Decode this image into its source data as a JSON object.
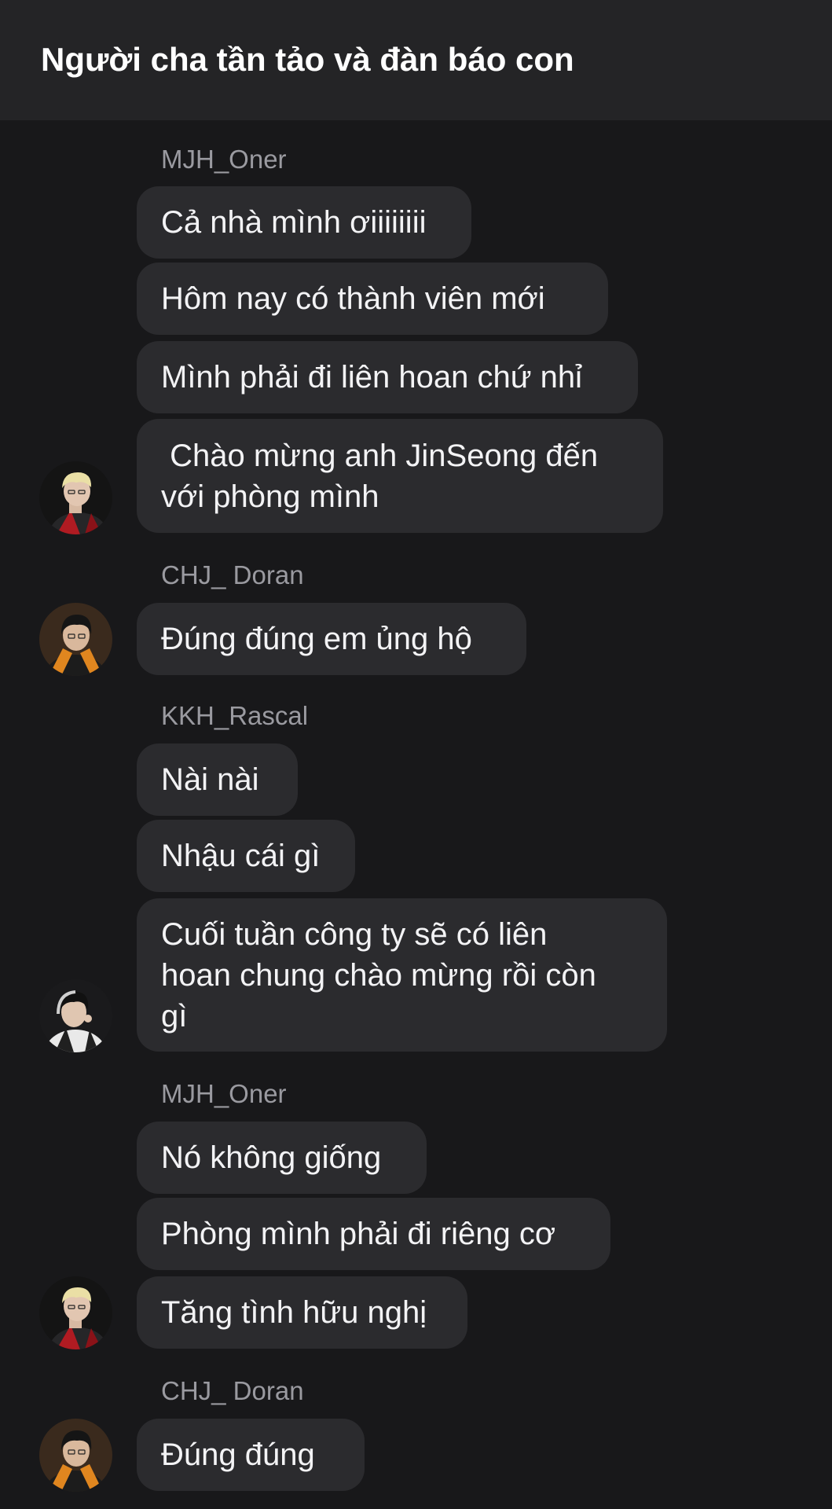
{
  "header": {
    "title": "Người cha tần tảo và đàn báo con"
  },
  "groups": [
    {
      "sender": "MJH_Oner",
      "avatar_icon": "oner-avatar-icon",
      "messages": [
        "Cả nhà mình ơiiiiiiii",
        "Hôm nay có thành viên mới",
        "Mình phải đi liên hoan chứ nhỉ",
        " Chào mừng anh JinSeong đến\nvới phòng mình"
      ]
    },
    {
      "sender": "CHJ_ Doran",
      "avatar_icon": "doran-avatar-icon",
      "messages": [
        "Đúng đúng em ủng hộ"
      ]
    },
    {
      "sender": "KKH_Rascal",
      "avatar_icon": "rascal-avatar-icon",
      "messages": [
        "Nài nài",
        "Nhậu cái gì",
        "Cuối tuần công ty sẽ có liên\nhoan chung chào mừng rồi còn\ngì"
      ]
    },
    {
      "sender": "MJH_Oner",
      "avatar_icon": "oner-avatar-icon",
      "messages": [
        "Nó không giống",
        "Phòng mình phải đi riêng cơ",
        "Tăng tình hữu nghị"
      ]
    },
    {
      "sender": "CHJ_ Doran",
      "avatar_icon": "doran-avatar-icon",
      "messages": [
        "Đúng đúng"
      ]
    }
  ],
  "colors": {
    "background": "#18181a",
    "header_background": "#242426",
    "bubble_background": "#2b2b2e",
    "sender_text": "#9a9aa0",
    "message_text": "#f3f3f5"
  }
}
